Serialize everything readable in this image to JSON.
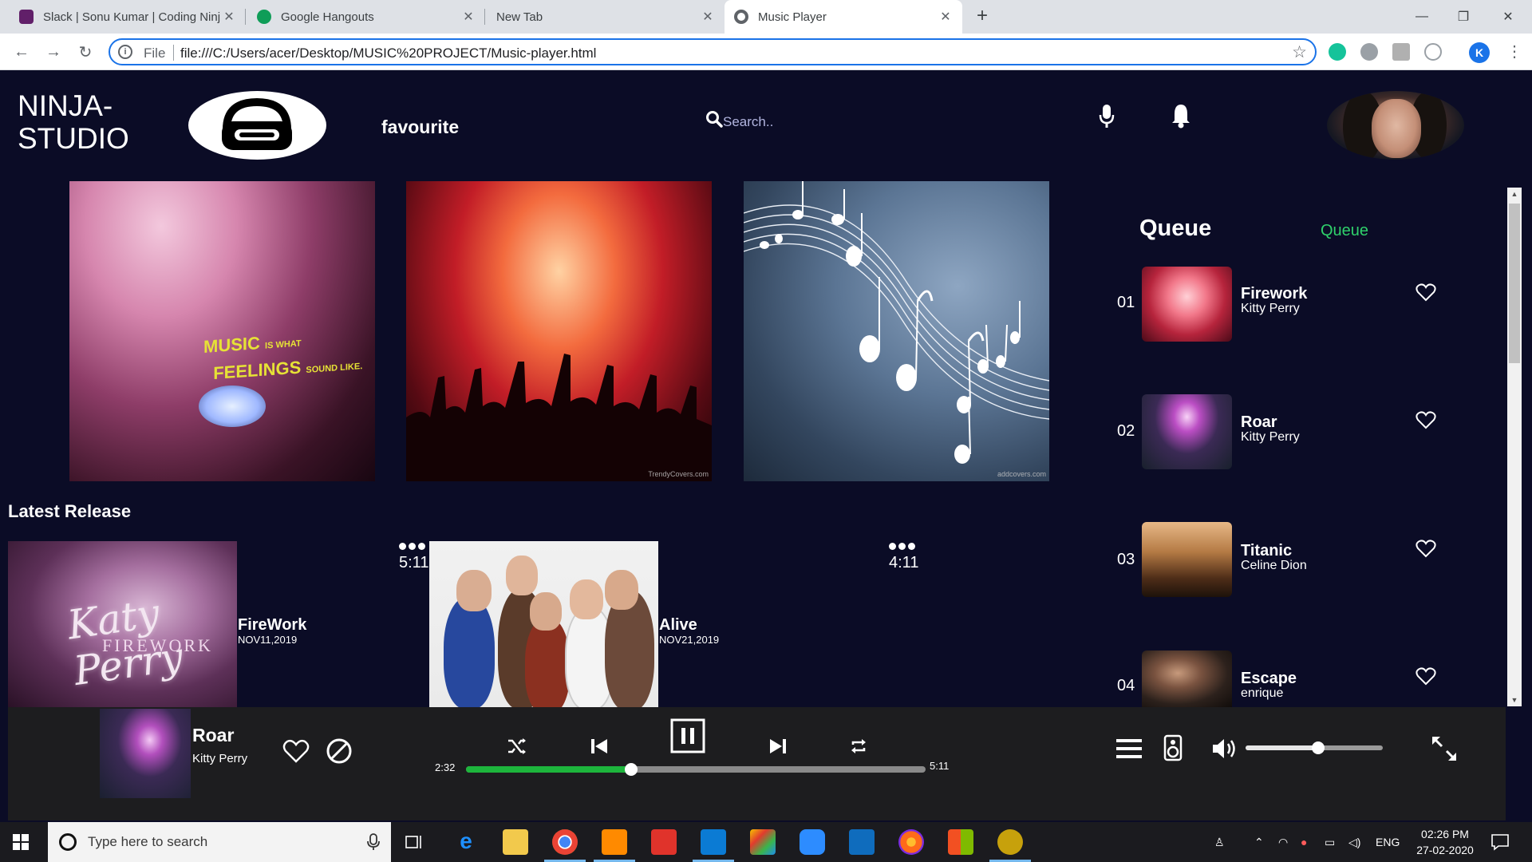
{
  "browser": {
    "tabs": [
      {
        "title": "Slack | Sonu Kumar | Coding Ninj",
        "favicon_color": "#611f69",
        "active": false
      },
      {
        "title": "Google Hangouts",
        "favicon_color": "#0f9d58",
        "active": false
      },
      {
        "title": "New Tab",
        "favicon_color": "",
        "active": false
      },
      {
        "title": "Music Player",
        "favicon_color": "#5f6368",
        "active": true
      }
    ],
    "new_tab_label": "+",
    "address": {
      "scheme": "File",
      "url": "file:///C:/Users/acer/Desktop/MUSIC%20PROJECT/Music-player.html"
    },
    "profile_initial": "K",
    "window_controls": {
      "minimize": "—",
      "maximize": "❐",
      "close": "✕"
    }
  },
  "app": {
    "logo": {
      "line1": "NINJA-",
      "line2": "STUDIO"
    },
    "nav_favourite": "favourite",
    "search": {
      "placeholder": "Search.."
    },
    "icons": {
      "search": "search-icon",
      "mic": "mic-icon",
      "bell": "bell-icon",
      "heart": "heart-icon",
      "block": "block-icon",
      "shuffle": "shuffle-icon",
      "prev": "skip-previous-icon",
      "pause": "pause-icon",
      "next": "skip-next-icon",
      "repeat": "repeat-icon",
      "menu": "menu-icon",
      "speaker": "speaker-icon",
      "volume": "volume-icon",
      "expand": "expand-icon"
    }
  },
  "banners": [
    {
      "image": "music-feelings-banner",
      "text_line1": "MUSIC",
      "text_line1_small": "IS WHAT",
      "text_line2": "FEELINGS",
      "text_line2_small": "SOUND LIKE."
    },
    {
      "image": "concert-crowd-banner",
      "watermark": "TrendyCovers.com"
    },
    {
      "image": "music-notes-banner",
      "watermark": "addcovers.com"
    }
  ],
  "latest_release": {
    "title": "Latest Release",
    "items": [
      {
        "name": "FireWork",
        "date": "NOV11,2019",
        "duration": "5:11",
        "art_text": "Katy Perry",
        "art_sub": "FIREWORK"
      },
      {
        "name": "Alive",
        "date": "NOV21,2019",
        "duration": "4:11"
      }
    ]
  },
  "queue": {
    "title": "Queue",
    "link": "Queue",
    "items": [
      {
        "num": "01",
        "title": "Firework",
        "artist": "Kitty Perry"
      },
      {
        "num": "02",
        "title": "Roar",
        "artist": "Kitty Perry"
      },
      {
        "num": "03",
        "title": "Titanic",
        "artist": "Celine Dion"
      },
      {
        "num": "04",
        "title": "Escape",
        "artist": "enrique"
      }
    ]
  },
  "player": {
    "title": "Roar",
    "artist": "Kitty Perry",
    "current_time": "2:32",
    "total_time": "5:11",
    "progress": 0.36,
    "volume": 0.53,
    "accent_color": "#1db53c"
  },
  "taskbar": {
    "search_placeholder": "Type here to search",
    "language": "ENG",
    "time": "02:26 PM",
    "date": "27-02-2020"
  }
}
